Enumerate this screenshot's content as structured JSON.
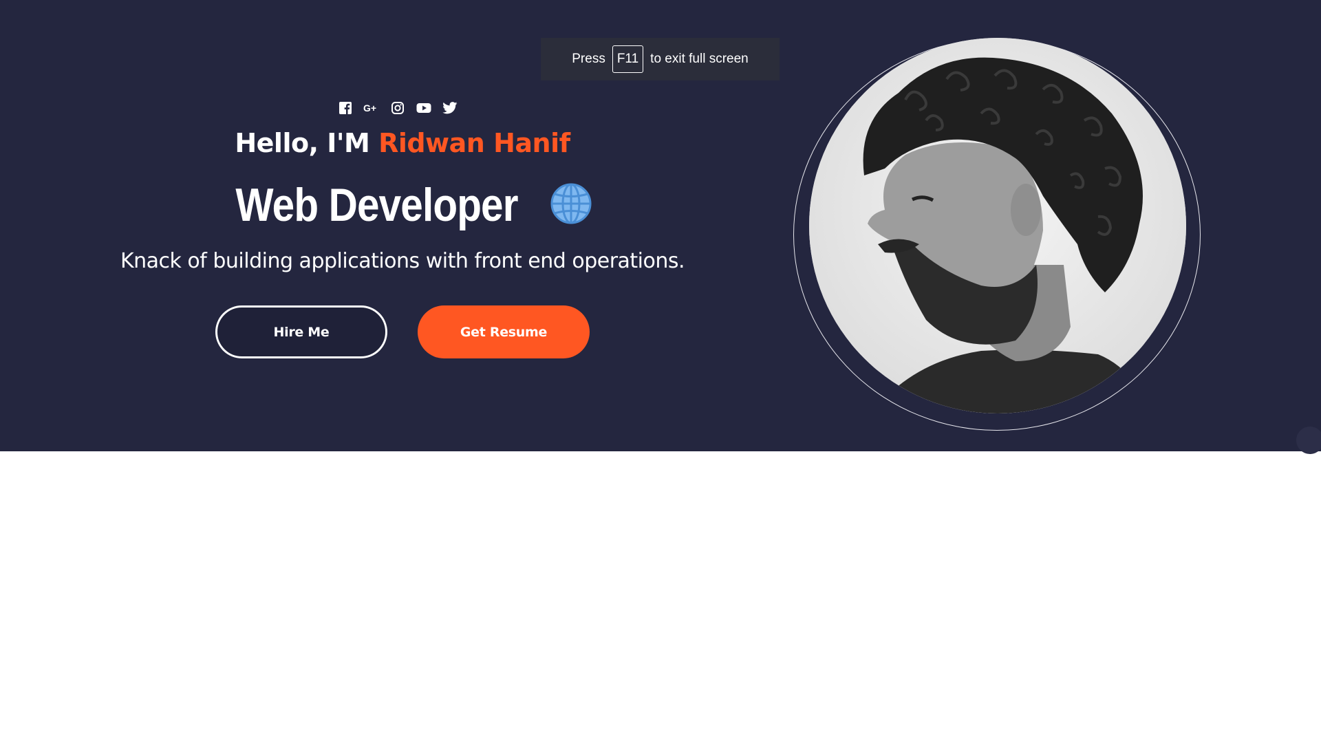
{
  "fullscreen_notice": {
    "before": "Press",
    "key": "F11",
    "after": "to exit full screen"
  },
  "social_icons": [
    "facebook-icon",
    "google-plus-icon",
    "instagram-icon",
    "youtube-icon",
    "twitter-icon"
  ],
  "hero": {
    "greeting": "Hello, I'M",
    "name": "Ridwan Hanif",
    "role": "Web Developer",
    "role_icon": "globe-icon",
    "tagline": "Knack of building applications with front end operations.",
    "hire_label": "Hire Me",
    "resume_label": "Get Resume"
  },
  "colors": {
    "background": "#24263f",
    "accent": "#ff5722",
    "text": "#ffffff"
  }
}
